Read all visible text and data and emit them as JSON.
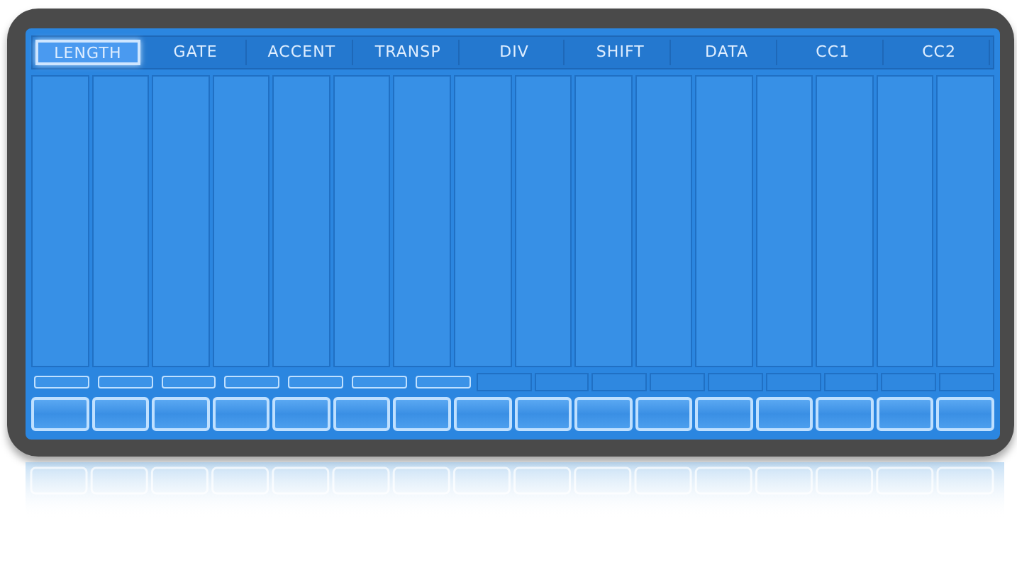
{
  "tabs": [
    {
      "label": "LENGTH",
      "selected": true
    },
    {
      "label": "GATE",
      "selected": false
    },
    {
      "label": "ACCENT",
      "selected": false
    },
    {
      "label": "TRANSP",
      "selected": false
    },
    {
      "label": "DIV",
      "selected": false
    },
    {
      "label": "SHIFT",
      "selected": false
    },
    {
      "label": "DATA",
      "selected": false
    },
    {
      "label": "CC1",
      "selected": false
    },
    {
      "label": "CC2",
      "selected": false
    }
  ],
  "steps": [
    {
      "active": true
    },
    {
      "active": true
    },
    {
      "active": true
    },
    {
      "active": true
    },
    {
      "active": true
    },
    {
      "active": true
    },
    {
      "active": true
    },
    {
      "active": false
    },
    {
      "active": false
    },
    {
      "active": false
    },
    {
      "active": false
    },
    {
      "active": false
    },
    {
      "active": false
    },
    {
      "active": false
    },
    {
      "active": false
    },
    {
      "active": false
    }
  ]
}
